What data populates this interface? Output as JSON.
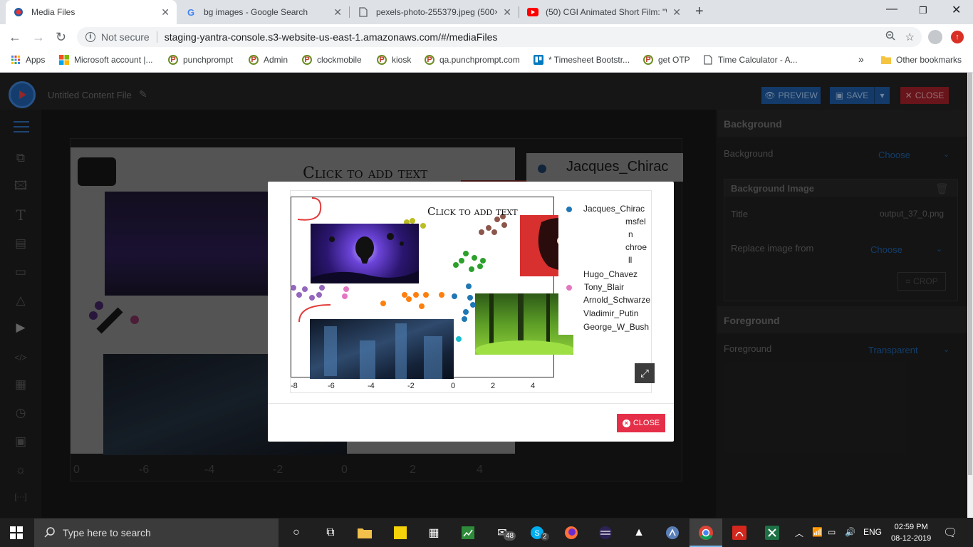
{
  "browser": {
    "tabs": [
      {
        "title": "Media Files",
        "active": true
      },
      {
        "title": "bg images - Google Search",
        "active": false
      },
      {
        "title": "pexels-photo-255379.jpeg (500×",
        "active": false
      },
      {
        "title": "(50) CGI Animated Short Film: \"W",
        "active": false
      }
    ],
    "security": "Not secure",
    "url": "staging-yantra-console.s3-website-us-east-1.amazonaws.com/#/mediaFiles",
    "bookmarks": [
      {
        "label": "Apps"
      },
      {
        "label": "Microsoft account |..."
      },
      {
        "label": "punchprompt"
      },
      {
        "label": "Admin"
      },
      {
        "label": "clockmobile"
      },
      {
        "label": "kiosk"
      },
      {
        "label": "qa.punchprompt.com"
      },
      {
        "label": "* Timesheet Bootstr..."
      },
      {
        "label": "get OTP"
      },
      {
        "label": "Time Calculator - A..."
      }
    ],
    "more_bookmarks": "»",
    "other_bookmarks": "Other bookmarks"
  },
  "app": {
    "file_title": "Untitled Content File",
    "preview_label": "PREVIEW",
    "save_label": "SAVE",
    "close_label": "CLOSE",
    "colors": {
      "accent": "#1e5aa0",
      "danger": "#e52f48"
    }
  },
  "panel": {
    "background_header": "Background",
    "background_label": "Background",
    "background_value": "Choose",
    "bg_image_header": "Background Image",
    "title_label": "Title",
    "title_value": "output_37_0.png",
    "replace_label": "Replace image from",
    "replace_value": "Choose",
    "crop_label": "CROP",
    "foreground_header": "Foreground",
    "foreground_label": "Foreground",
    "foreground_value": "Transparent"
  },
  "modal": {
    "close_label": "CLOSE",
    "image_text": "Click to add text",
    "legend": [
      {
        "name": "Jacques_Chirac",
        "color": "#1f77b4"
      },
      {
        "name": "msfel",
        "color": "#ff7f0e"
      },
      {
        "name": "n",
        "color": "#2ca02c"
      },
      {
        "name": "chroe",
        "color": "#d62728"
      },
      {
        "name": "ll",
        "color": "#9467bd"
      },
      {
        "name": "Hugo_Chavez",
        "color": "#8c564b"
      },
      {
        "name": "Tony_Blair",
        "color": "#e377c2"
      },
      {
        "name": "Arnold_Schwarze",
        "color": "#7f7f7f"
      },
      {
        "name": "Vladimir_Putin",
        "color": "#bcbd22"
      },
      {
        "name": "George_W_Bush",
        "color": "#17becf"
      }
    ],
    "x_ticks": [
      "-8",
      "-6",
      "-4",
      "-2",
      "0",
      "2",
      "4"
    ]
  },
  "behind": {
    "canvas_text": "Click to add text",
    "legend_first": "Jacques_Chirac",
    "x_ticks": [
      "0",
      "-6",
      "-4",
      "-2",
      "0",
      "2",
      "4"
    ]
  },
  "taskbar": {
    "search_placeholder": "Type here to search",
    "mail_badge": "48",
    "skype_badge": "2",
    "lang": "ENG",
    "time": "02:59 PM",
    "date": "08-12-2019"
  }
}
